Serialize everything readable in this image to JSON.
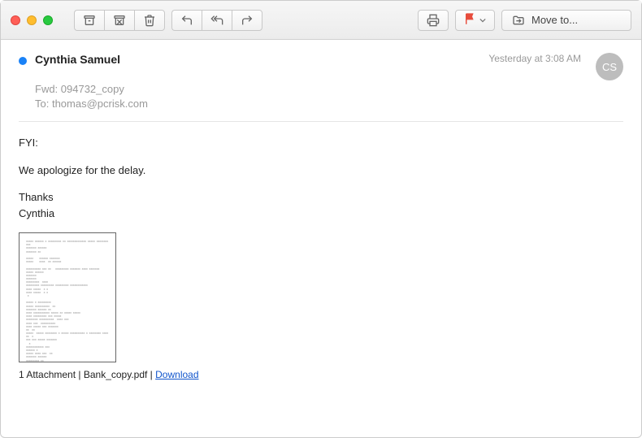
{
  "toolbar": {
    "move_to_label": "Move to..."
  },
  "header": {
    "sender_name": "Cynthia Samuel",
    "timestamp": "Yesterday at 3:08 AM",
    "avatar_initials": "CS",
    "subject": "Fwd: 094732_copy",
    "to_label": "To:",
    "to_value": "thomas@pcrisk.com"
  },
  "body": {
    "line1": "FYI:",
    "line2": "We apologize for the delay.",
    "line3": "Thanks",
    "line4": "Cynthia"
  },
  "attachment": {
    "count_text": "1 Attachment",
    "separator": " | ",
    "filename": "Bank_copy.pdf",
    "download_label": "Download"
  }
}
